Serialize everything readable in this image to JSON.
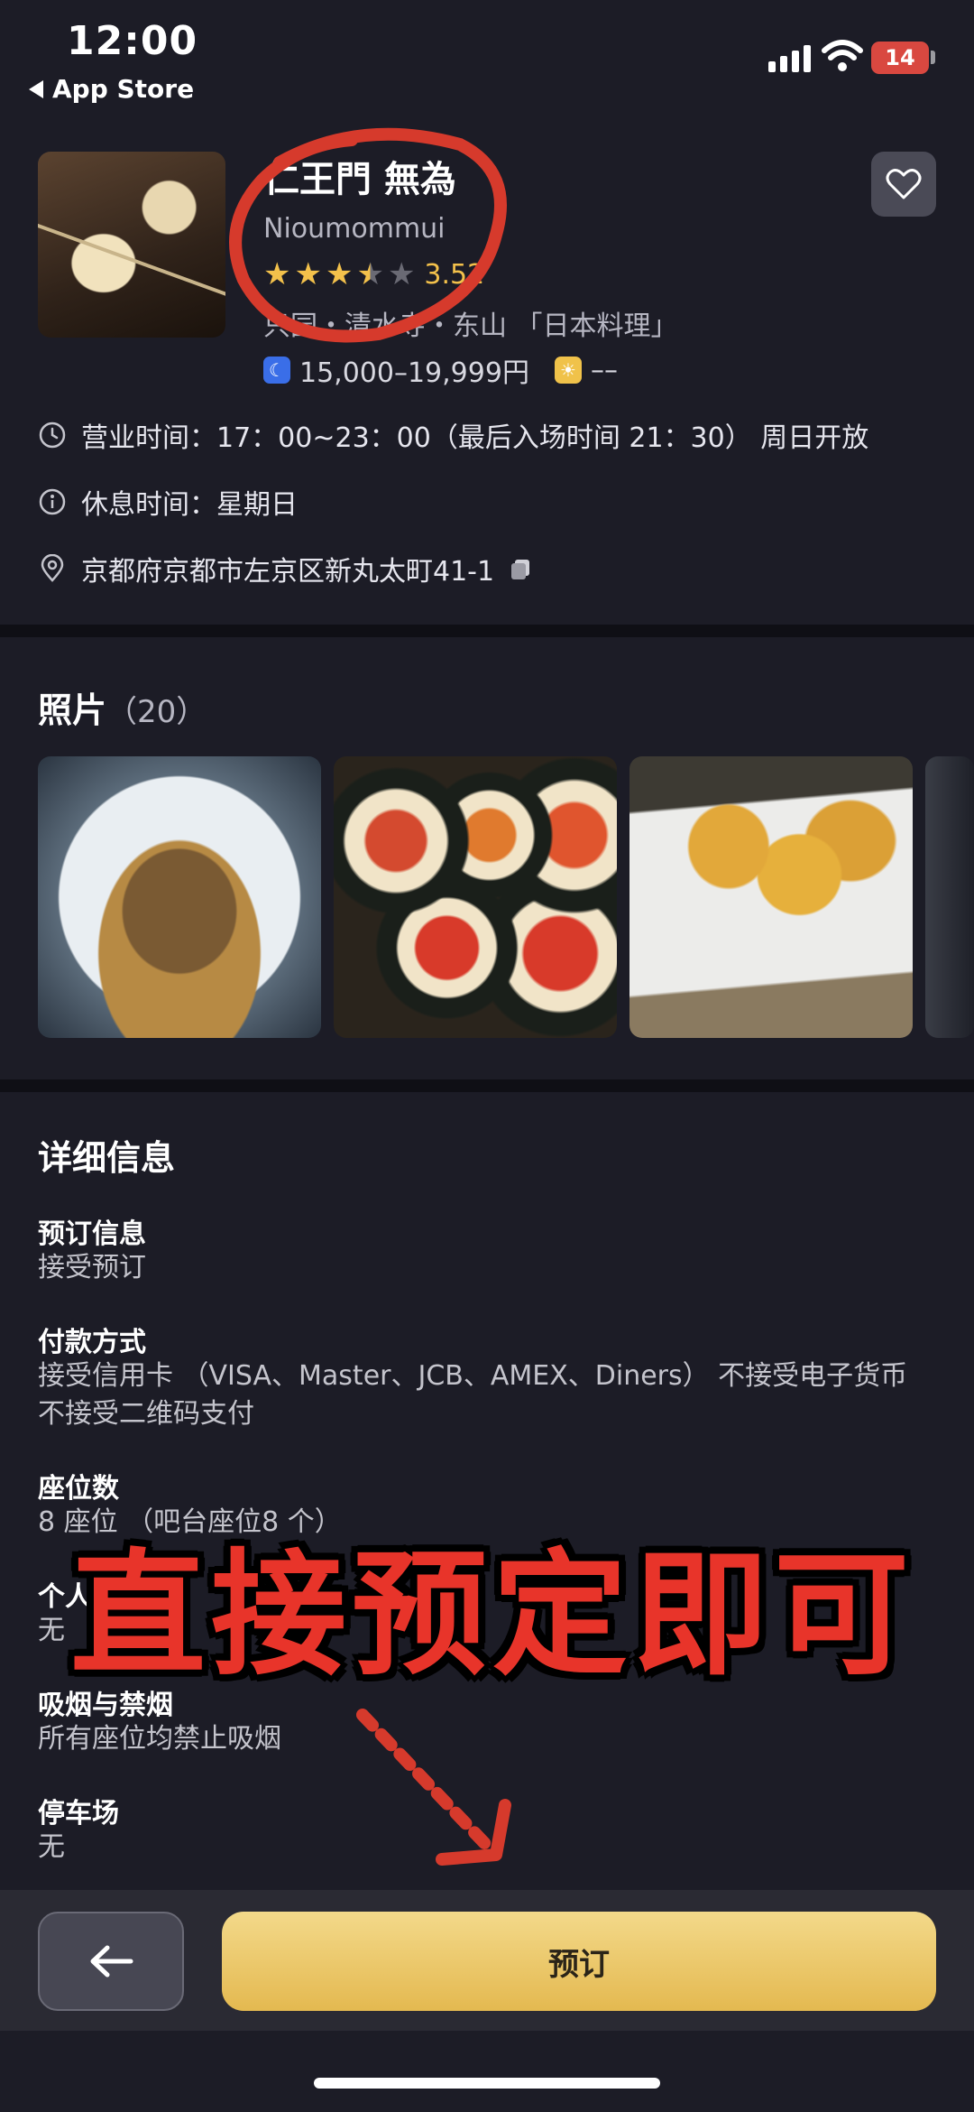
{
  "status_bar": {
    "time": "12:00",
    "back_app": "App Store",
    "battery": "14"
  },
  "restaurant": {
    "name": "仁王門 無為",
    "romaji": "Nioumommui",
    "rating": "3.52",
    "rating_stars": 3.5,
    "area_genre": "只园・清水寺・东山 「日本料理」",
    "dinner_price": "15,000–19,999円",
    "lunch_price": "––"
  },
  "info": {
    "hours": "营业时间：17：00~23：00（最后入场时间 21：30） 周日开放",
    "closed": "休息时间：星期日",
    "address": "京都府京都市左京区新丸太町41-1"
  },
  "photos": {
    "title": "照片",
    "count": "（20）"
  },
  "details": {
    "title": "详细信息",
    "items": [
      {
        "label": "预订信息",
        "value": "接受预订"
      },
      {
        "label": "付款方式",
        "value": "接受信用卡 （VISA、Master、JCB、AMEX、Diners） 不接受电子货币 不接受二维码支付"
      },
      {
        "label": "座位数",
        "value": "8 座位 （吧台座位8 个）"
      },
      {
        "label": "个人包间",
        "value": "无"
      },
      {
        "label": "吸烟与禁烟",
        "value": "所有座位均禁止吸烟"
      },
      {
        "label": "停车场",
        "value": "无"
      }
    ]
  },
  "overlay": {
    "caption": "直接预定即可"
  },
  "bottom": {
    "book_label": "预订"
  },
  "colors": {
    "background": "#1c1c26",
    "star": "#f3c14b",
    "book_button": "#e8c466",
    "annotation": "#e8342a"
  }
}
